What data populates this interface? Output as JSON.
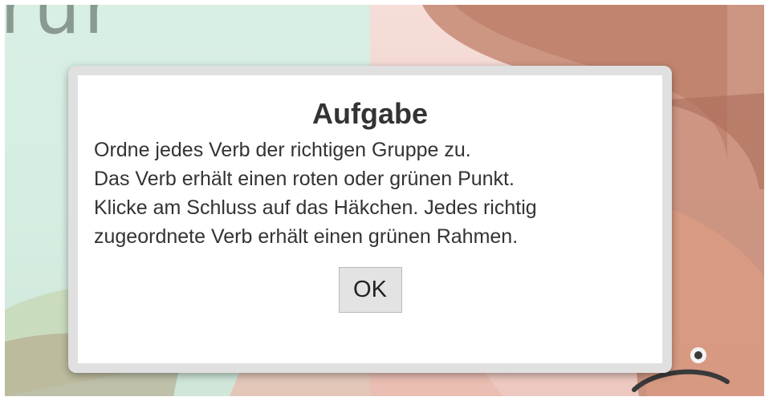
{
  "background": {
    "word_fragment": "rur",
    "colors": {
      "left_panel": "#d8efe4",
      "right_panel": "#f2d3cd",
      "hand": "#c98a72",
      "frown": "#3a3a3a"
    },
    "image_icons": [
      "hand-thumbs-down-icon",
      "frown-face-icon"
    ]
  },
  "dialog": {
    "title": "Aufgabe",
    "lines": [
      "Ordne jedes Verb der richtigen Gruppe zu.",
      "Das Verb erhält einen roten oder grünen Punkt.",
      "Klicke am Schluss auf das Häkchen. Jedes richtig",
      "zugeordnete Verb erhält einen grünen Rahmen."
    ],
    "ok_label": "OK",
    "colors": {
      "frame": "#e0e0e0",
      "text": "#333333",
      "button": "#e3e3e3"
    }
  }
}
